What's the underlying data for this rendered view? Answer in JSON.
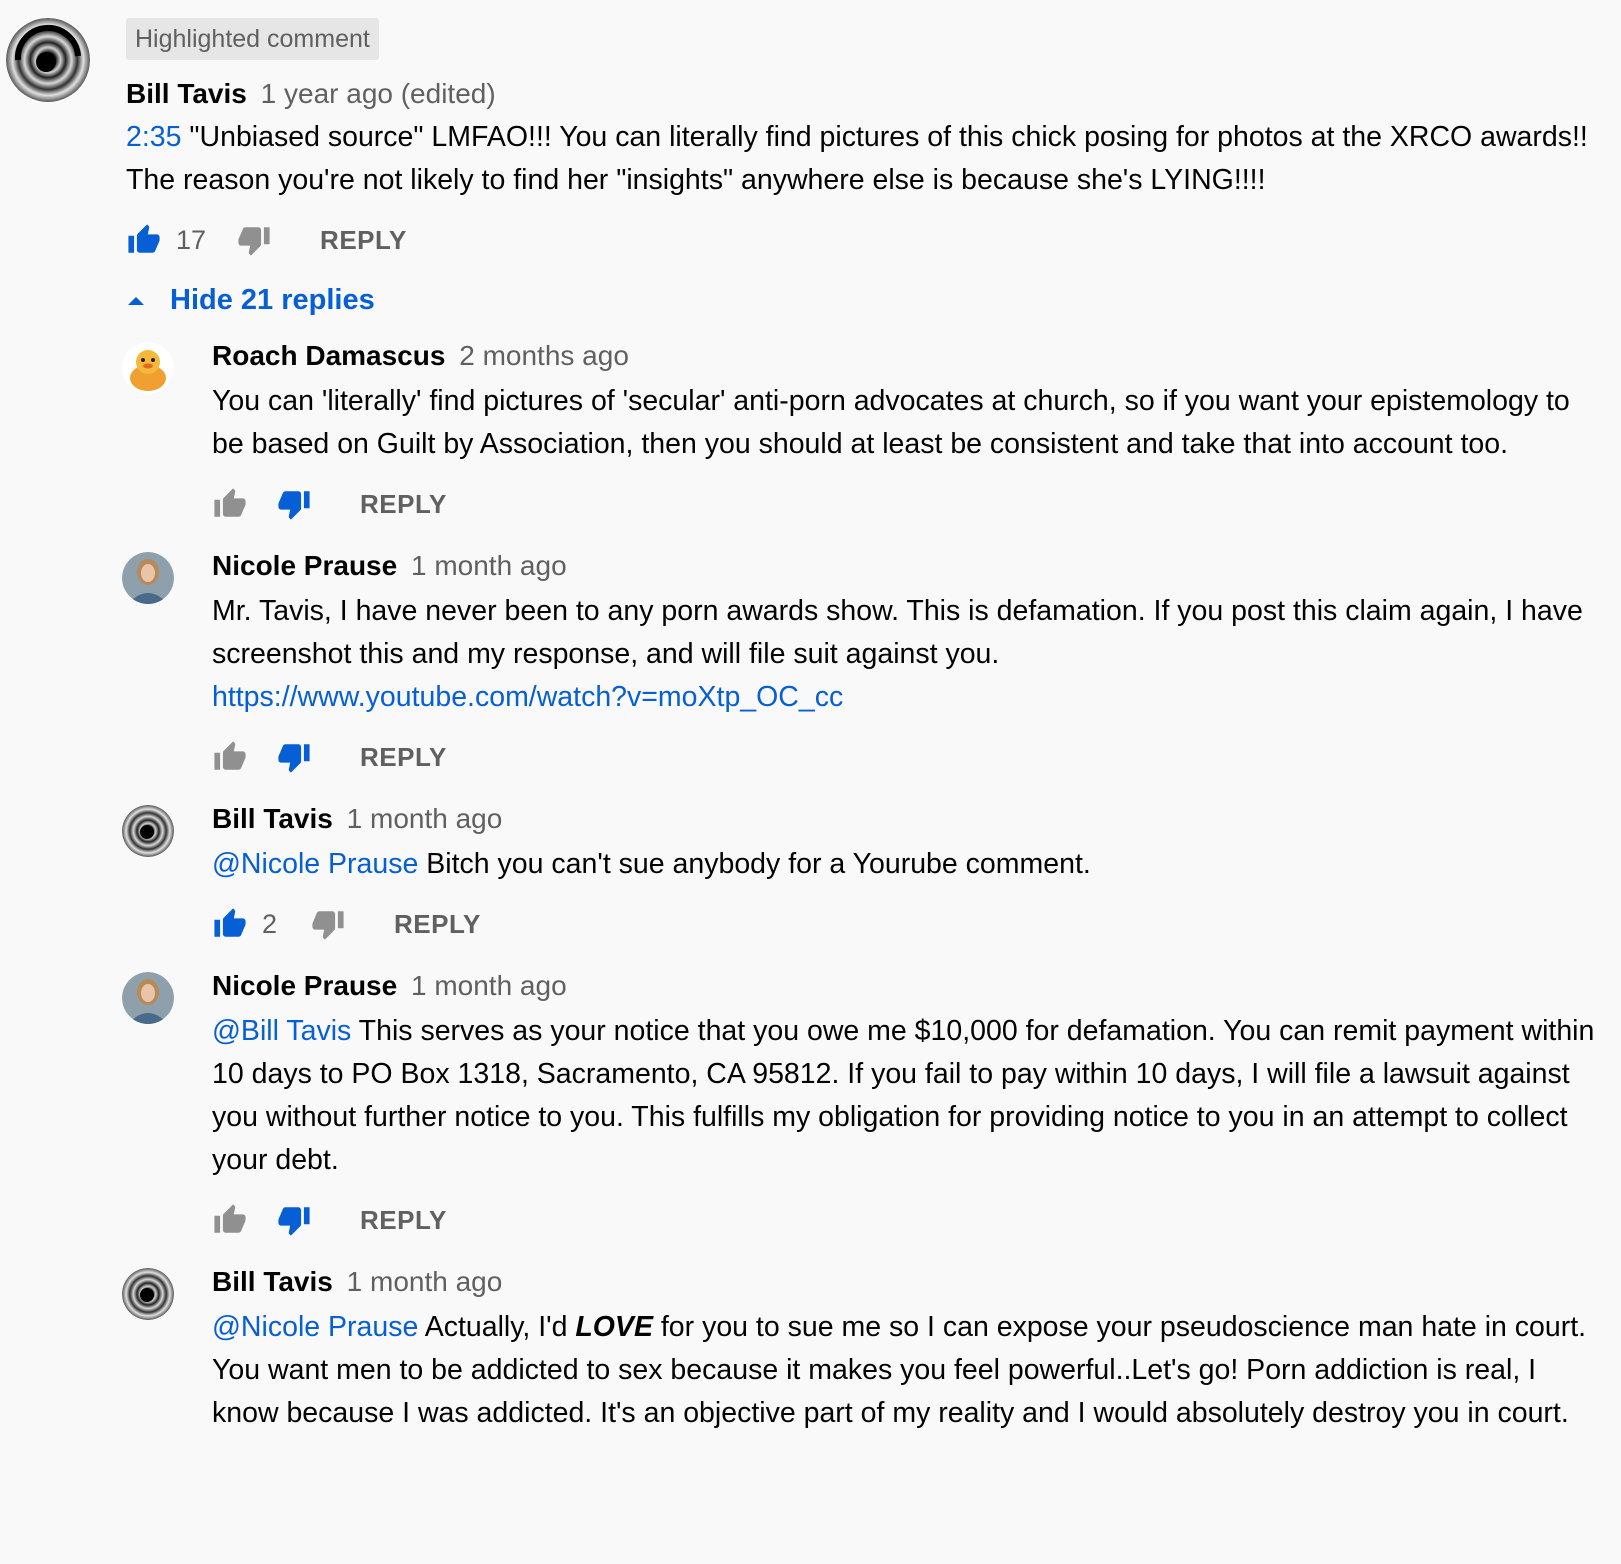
{
  "highlight_badge": "Highlighted comment",
  "top_comment": {
    "author": "Bill Tavis",
    "time": "1 year ago (edited)",
    "timestamp_link": "2:35",
    "text": " \"Unbiased source\" LMFAO!!! You can literally find pictures of this chick posing for photos at the XRCO awards!! The reason you're not likely to find her \"insights\" anywhere else is because she's LYING!!!!",
    "likes": "17",
    "reply_label": "REPLY"
  },
  "toggle_label": "Hide 21 replies",
  "replies": [
    {
      "author": "Roach Damascus",
      "time": "2 months ago",
      "text": "You can 'literally' find pictures of 'secular' anti-porn advocates at church, so if you want your epistemology to be based on Guilt by Association, then you should at least be consistent and take that into account too.",
      "reply_label": "REPLY"
    },
    {
      "author": "Nicole Prause",
      "time": "1 month ago",
      "text": "Mr. Tavis, I have never been to any porn awards show. This is defamation. If you post this claim again, I have screenshot this and my response, and will file suit against you.",
      "link": "https://www.youtube.com/watch?v=moXtp_OC_cc",
      "reply_label": "REPLY"
    },
    {
      "author": "Bill Tavis",
      "time": "1 month ago",
      "mention": "@Nicole Prause",
      "text": " Bitch you can't sue anybody for a Yourube comment.",
      "likes": "2",
      "reply_label": "REPLY"
    },
    {
      "author": "Nicole Prause",
      "time": "1 month ago",
      "mention": "@Bill Tavis",
      "text": " This serves as your notice that you owe me $10,000 for defamation. You can remit payment within 10 days to PO Box 1318, Sacramento, CA 95812. If you fail to pay within 10 days, I will file a lawsuit against you without further notice to you. This fulfills my obligation for providing notice to you in an attempt to collect your debt.",
      "reply_label": "REPLY"
    },
    {
      "author": "Bill Tavis",
      "time": "1 month ago",
      "mention": "@Nicole Prause",
      "text_before": " Actually, I'd ",
      "emphasis": "LOVE",
      "text_after": " for you to sue me so I can expose your pseudoscience man hate in court. You want men to be addicted to sex because it makes you feel powerful..Let's go! Porn addiction is real, I know because I was addicted. It's an objective part of my reality and I would absolutely destroy you in court."
    }
  ],
  "colors": {
    "link": "#065fd4",
    "meta": "#606060",
    "liked": "#065fd4",
    "inactive_icon": "#909090"
  },
  "icons": [
    "thumb-up-icon",
    "thumb-down-icon",
    "caret-up-icon",
    "avatar-swirl",
    "avatar-duck",
    "avatar-person"
  ]
}
